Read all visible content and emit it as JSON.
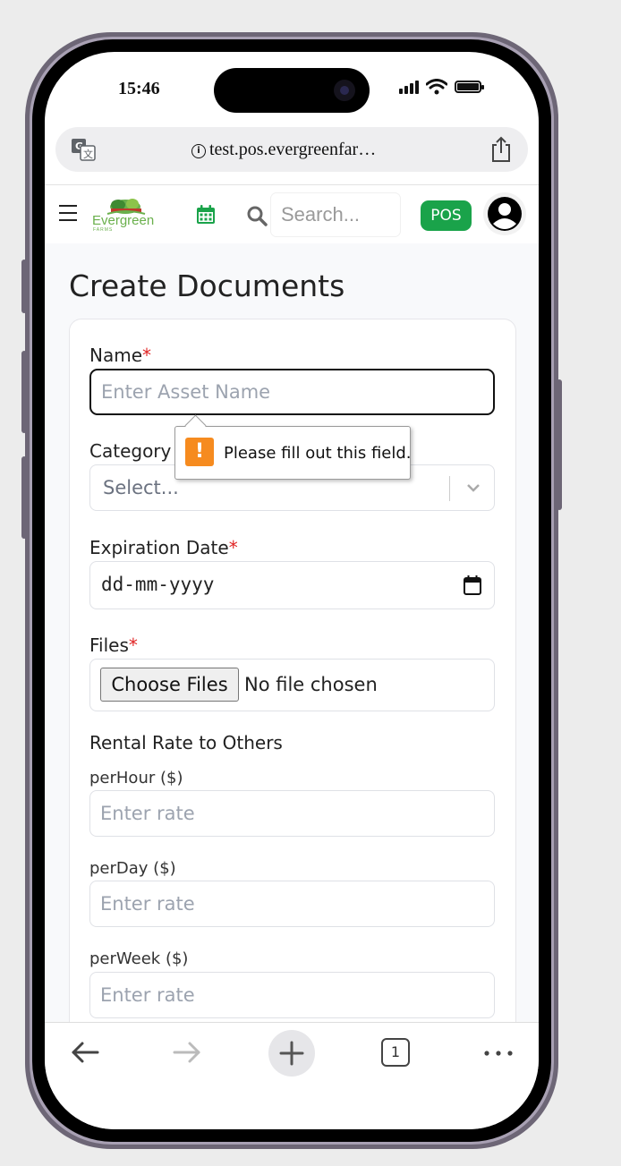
{
  "status_bar": {
    "time": "15:46"
  },
  "browser": {
    "url": "test.pos.evergreenfar…",
    "tab_count": "1"
  },
  "header": {
    "logo_text": "Evergreen",
    "logo_subtext": "FARMS",
    "search_placeholder": "Search...",
    "pos_label": "POS"
  },
  "page": {
    "title": "Create Documents"
  },
  "form": {
    "name_label": "Name",
    "name_placeholder": "Enter Asset Name",
    "category_label": "Category",
    "category_value": "Select...",
    "expiration_label": "Expiration Date",
    "expiration_value": "dd-mm-yyyy",
    "files_label": "Files",
    "choose_files_label": "Choose Files",
    "no_file_text": "No file chosen",
    "rental_section_label": "Rental Rate to Others",
    "per_hour_label": "perHour ($)",
    "per_day_label": "perDay ($)",
    "per_week_label": "perWeek ($)",
    "rate_placeholder": "Enter rate",
    "required_mark": "*"
  },
  "validation_tooltip": {
    "message": "Please fill out this field.",
    "icon_glyph": "!"
  },
  "colors": {
    "accent_green": "#1aa34a",
    "required_red": "#e02424",
    "warning_orange": "#f68b1f"
  }
}
